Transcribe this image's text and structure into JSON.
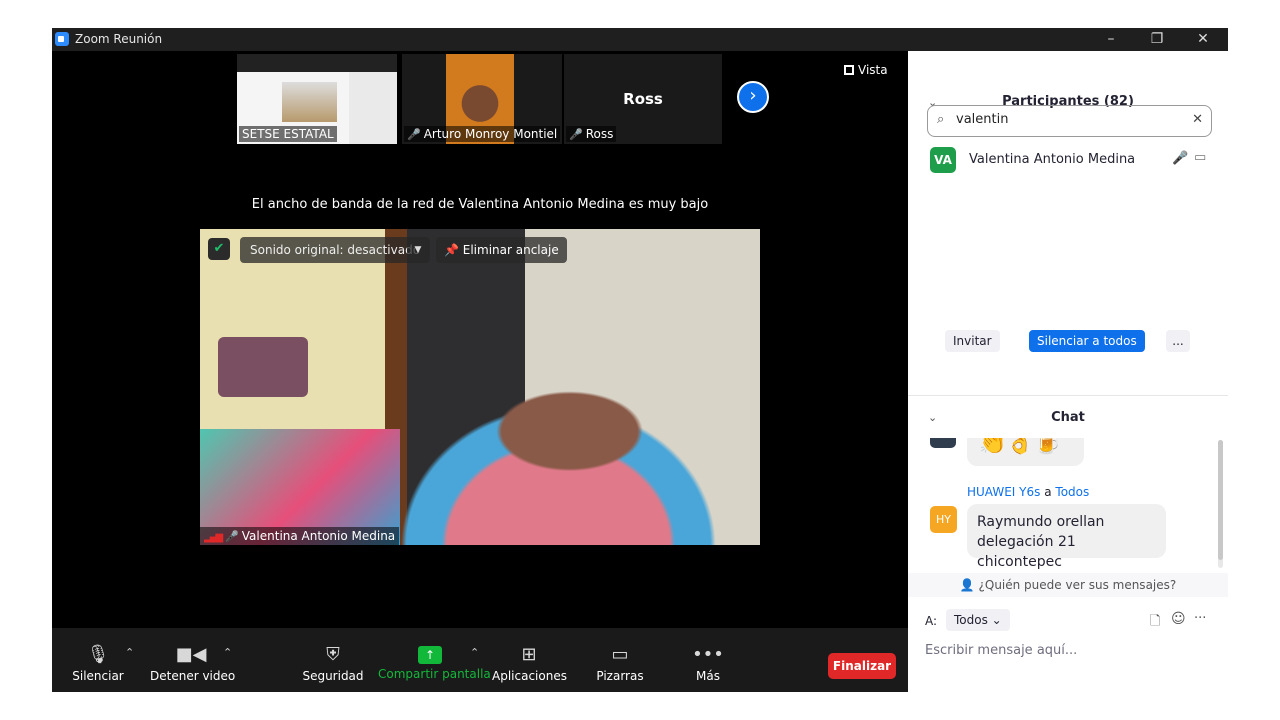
{
  "window": {
    "title": "Zoom Reunión",
    "minimize": "–",
    "restore": "❐",
    "close": "✕"
  },
  "strip": {
    "thumbnails": [
      {
        "label": "SETSE ESTATAL"
      },
      {
        "label": "Arturo Monroy Montiel",
        "muted": true
      },
      {
        "label": "Ross",
        "muted": true,
        "name": "Ross"
      }
    ],
    "next": "›"
  },
  "view": {
    "label": "Vista"
  },
  "notice": "El ancho de banda de la red de Valentina Antonio Medina es muy bajo",
  "main_video": {
    "original_sound": "Sonido original: desactivado",
    "unpin": "Eliminar anclaje",
    "name": "Valentina Antonio Medina"
  },
  "toolbar": {
    "mute": "Silenciar",
    "video": "Detener video",
    "security": "Seguridad",
    "share": "Compartir pantalla",
    "apps": "Aplicaciones",
    "whiteboards": "Pizarras",
    "more": "Más",
    "end": "Finalizar",
    "accent": "#12b83a",
    "end_color": "#e02828"
  },
  "participants": {
    "title": "Participantes (82)",
    "search_value": "valentin",
    "list": [
      {
        "initials": "VA",
        "name": "Valentina Antonio Medina",
        "avatar_color": "#1e9e4b"
      }
    ],
    "invite": "Invitar",
    "mute_all": "Silenciar a todos",
    "more": "..."
  },
  "chat": {
    "title": "Chat",
    "emoji_message": "👏👌🍺",
    "message": {
      "sender": "HUAWEI Y6s",
      "connector": "a",
      "recipient": "Todos",
      "initials": "HY",
      "text_line1": "Raymundo orellan",
      "text_line2": "delegación 21 chicontepec",
      "avatar_color": "#f5a623"
    },
    "who_can_see": "¿Quién puede ver sus mensajes?",
    "to_label": "A:",
    "to_value": "Todos",
    "placeholder": "Escribir mensaje aquí..."
  }
}
